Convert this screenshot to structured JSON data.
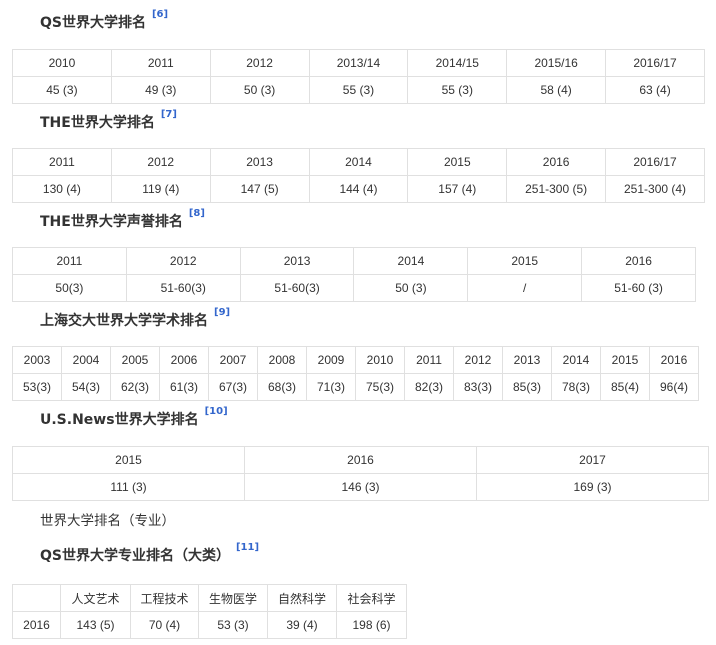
{
  "sections": [
    {
      "title": "QS世界大学排名",
      "ref": "[6]",
      "years": [
        "2010",
        "2011",
        "2012",
        "2013/14",
        "2014/15",
        "2015/16",
        "2016/17"
      ],
      "ranks": [
        "45 (3)",
        "49 (3)",
        "50 (3)",
        "55 (3)",
        "55 (3)",
        "58 (4)",
        "63 (4)"
      ]
    },
    {
      "title": "THE世界大学排名",
      "ref": "[7]",
      "years": [
        "2011",
        "2012",
        "2013",
        "2014",
        "2015",
        "2016",
        "2016/17"
      ],
      "ranks": [
        "130 (4)",
        "119 (4)",
        "147 (5)",
        "144 (4)",
        "157 (4)",
        "251-300 (5)",
        "251-300 (4)"
      ]
    },
    {
      "title": "THE世界大学声誉排名",
      "ref": "[8]",
      "years": [
        "2011",
        "2012",
        "2013",
        "2014",
        "2015",
        "2016"
      ],
      "ranks": [
        "50(3)",
        "51-60(3)",
        "51-60(3)",
        "50 (3)",
        "/",
        "51-60 (3)"
      ]
    },
    {
      "title": "上海交大世界大学学术排名",
      "ref": "[9]",
      "years": [
        "2003",
        "2004",
        "2005",
        "2006",
        "2007",
        "2008",
        "2009",
        "2010",
        "2011",
        "2012",
        "2013",
        "2014",
        "2015",
        "2016"
      ],
      "ranks": [
        "53(3)",
        "54(3)",
        "62(3)",
        "61(3)",
        "67(3)",
        "68(3)",
        "71(3)",
        "75(3)",
        "82(3)",
        "83(3)",
        "85(3)",
        "78(3)",
        "85(4)",
        "96(4)"
      ]
    },
    {
      "title": "U.S.News世界大学排名",
      "ref": "[10]",
      "years": [
        "2015",
        "2016",
        "2017"
      ],
      "ranks": [
        "111 (3)",
        "146 (3)",
        "169 (3)"
      ]
    }
  ],
  "subject_intro": "世界大学排名（专业）",
  "subject": {
    "title": "QS世界大学专业排名（大类）",
    "ref": "[11]",
    "header": [
      "",
      "人文艺术",
      "工程技术",
      "生物医学",
      "自然科学",
      "社会科学"
    ],
    "row": [
      "2016",
      "143 (5)",
      "70 (4)",
      "53 (3)",
      "39 (4)",
      "198 (6)"
    ]
  }
}
